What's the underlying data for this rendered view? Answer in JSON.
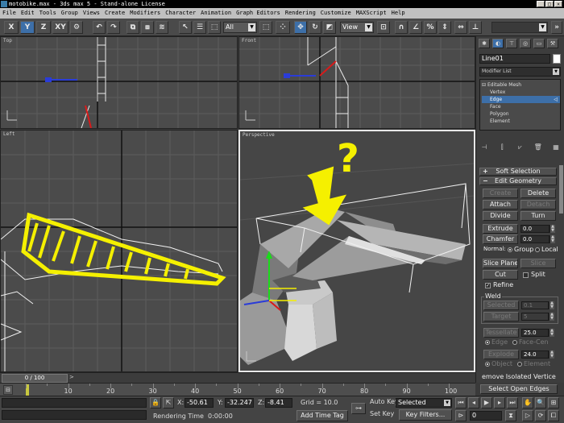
{
  "window": {
    "title": "motobike.max - 3ds max 5 - Stand-alone License",
    "buttons": [
      "_",
      "□",
      "×"
    ]
  },
  "menu": [
    "File",
    "Edit",
    "Tools",
    "Group",
    "Views",
    "Create",
    "Modifiers",
    "Character",
    "Animation",
    "Graph Editors",
    "Rendering",
    "Customize",
    "MAXScript",
    "Help"
  ],
  "toolbar": {
    "axis_x": "X",
    "axis_y": "Y",
    "axis_z": "Z",
    "axis_xy": "XY",
    "selection_filter": "All",
    "ref_coord": "View",
    "active_axis": "Y",
    "named_selection": ""
  },
  "viewports": {
    "top": "Top",
    "front": "Front",
    "left": "Left",
    "perspective": "Perspective",
    "annotation": "?"
  },
  "command_panel": {
    "object_name": "Line01",
    "modifier_list": "Modifier List",
    "stack": [
      {
        "label": "Editable Mesh",
        "selected": false
      },
      {
        "label": "Vertex",
        "selected": false
      },
      {
        "label": "Edge",
        "selected": true
      },
      {
        "label": "Face",
        "selected": false
      },
      {
        "label": "Polygon",
        "selected": false
      },
      {
        "label": "Element",
        "selected": false
      }
    ],
    "soft_selection": "Soft Selection",
    "edit_geometry": "Edit Geometry",
    "buttons": {
      "create": "Create",
      "delete": "Delete",
      "attach": "Attach",
      "detach": "Detach",
      "divide": "Divide",
      "turn": "Turn",
      "extrude": "Extrude",
      "chamfer": "Chamfer",
      "slice_plane": "Slice Plane",
      "slice": "Slice",
      "cut": "Cut",
      "selected": "Selected",
      "target": "Target",
      "tessellate": "Tessellate",
      "explode": "Explode",
      "remove_isolated": "emove Isolated Vertice",
      "select_open_edges": "Select Open Edges"
    },
    "values": {
      "extrude": "0.0",
      "chamfer": "0.0",
      "weld_selected": "0.1",
      "weld_target": "5",
      "tessellate": "25.0",
      "explode": "24.0"
    },
    "labels": {
      "normal": "Normal:",
      "group": "Group",
      "local": "Local",
      "split": "Split",
      "refine": "Refine",
      "weld": "Weld",
      "edge": "Edge",
      "face_center": "Face-Cen",
      "objects": "Object",
      "elements": "Element"
    }
  },
  "timeline": {
    "slider": "0 / 100",
    "ticks": [
      "10",
      "20",
      "30",
      "40",
      "50",
      "60",
      "70",
      "80",
      "90",
      "100"
    ]
  },
  "status": {
    "x_label": "X:",
    "x": "-50.61",
    "y_label": "Y:",
    "y": "-32.247",
    "z_label": "Z:",
    "z": "-8.41",
    "grid": "Grid = 10.0",
    "rendering_time_label": "Rendering Time",
    "rendering_time": "0:00:00",
    "add_time_tag": "Add Time Tag",
    "auto_key": "Auto Key",
    "set_key": "Set Key",
    "key_mode": "Selected",
    "key_filters": "Key Filters...",
    "frame": "0"
  },
  "colors": {
    "active_blue": "#3d6fa8",
    "annotation_yellow": "#f5f000"
  }
}
